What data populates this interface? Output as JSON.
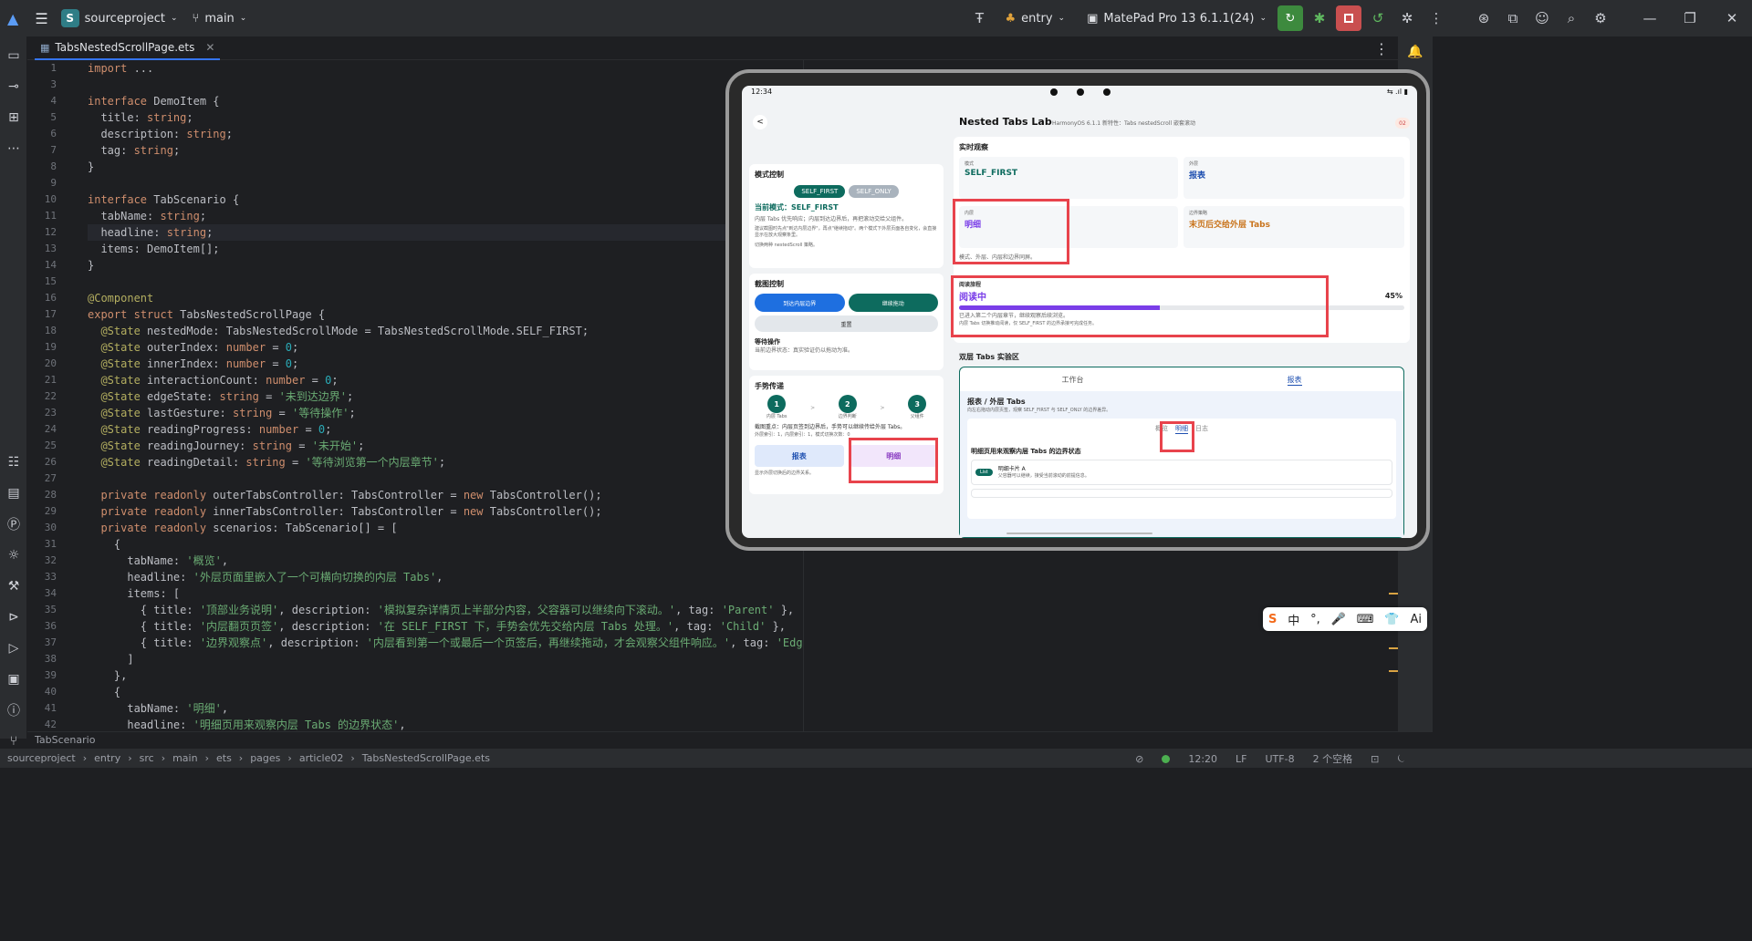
{
  "topbar": {
    "project_badge": "S",
    "project_name": "sourceproject",
    "branch": "main",
    "run_config": "entry",
    "device": "MatePad Pro 13 6.1.1(24)"
  },
  "editor": {
    "tab_name": "TabsNestedScrollPage.ets",
    "line_numbers": [
      "1",
      "3",
      "4",
      "5",
      "6",
      "7",
      "8",
      "9",
      "10",
      "11",
      "12",
      "13",
      "14",
      "15",
      "16",
      "17",
      "18",
      "19",
      "20",
      "21",
      "22",
      "23",
      "24",
      "25",
      "26",
      "27",
      "28",
      "29",
      "30",
      "31",
      "32",
      "33",
      "34",
      "35",
      "36",
      "37",
      "38",
      "39",
      "40",
      "41",
      "42"
    ],
    "code_lines": [
      "import ...",
      "",
      "interface DemoItem {",
      "  title: string;",
      "  description: string;",
      "  tag: string;",
      "}",
      "",
      "interface TabScenario {",
      "  tabName: string;",
      "  headline: string;",
      "  items: DemoItem[];",
      "}",
      "",
      "@Component",
      "export struct TabsNestedScrollPage {",
      "  @State nestedMode: TabsNestedScrollMode = TabsNestedScrollMode.SELF_FIRST;",
      "  @State outerIndex: number = 0;",
      "  @State innerIndex: number = 0;",
      "  @State interactionCount: number = 0;",
      "  @State edgeState: string = '未到达边界';",
      "  @State lastGesture: string = '等待操作';",
      "  @State readingProgress: number = 0;",
      "  @State readingJourney: string = '未开始';",
      "  @State readingDetail: string = '等待浏览第一个内层章节';",
      "",
      "  private readonly outerTabsController: TabsController = new TabsController();",
      "  private readonly innerTabsController: TabsController = new TabsController();",
      "  private readonly scenarios: TabScenario[] = [",
      "    {",
      "      tabName: '概览',",
      "      headline: '外层页面里嵌入了一个可横向切换的内层 Tabs',",
      "      items: [",
      "        { title: '顶部业务说明', description: '模拟复杂详情页上半部分内容，父容器可以继续向下滚动。', tag: 'Parent' },",
      "        { title: '内层翻页页签', description: '在 SELF_FIRST 下，手势会优先交给内层 Tabs 处理。', tag: 'Child' },",
      "        { title: '边界观察点', description: '内层看到第一个或最后一个页签后，再继续拖动，才会观察父组件响应。', tag: 'Edge' }",
      "      ]",
      "    },",
      "    {",
      "      tabName: '明细',",
      "      headline: '明细页用来观察内层 Tabs 的边界状态',"
    ],
    "bottom_crumb": "TabScenario"
  },
  "statusbar": {
    "path": [
      "sourceproject",
      "entry",
      "src",
      "main",
      "ets",
      "pages",
      "article02",
      "TabsNestedScrollPage.ets"
    ],
    "position": "12:20",
    "line_sep": "LF",
    "encoding": "UTF-8",
    "indent": "2 个空格"
  },
  "device_screen": {
    "time": "12:34",
    "back": "<",
    "title": "Nested Tabs Lab",
    "subtitle": "HarmonyOS 6.1.1 新特性：Tabs nestedScroll 嵌套滚动",
    "badge": "02",
    "mode_control": {
      "title": "模式控制",
      "btn_self_first": "SELF_FIRST",
      "btn_self_only": "SELF_ONLY",
      "current_mode": "当前模式：SELF_FIRST",
      "desc1": "内层 Tabs 优先响应；内层到达边界后，再把滚动交给父组件。",
      "desc2": "建议截图时先点\"到达内层边界\"，再点\"继续拖动\"。两个模式下外层页面各自变化，会直接显示在放大观察条里。",
      "desc3": "切换两种 nestedScroll 策略。"
    },
    "screenshot_control": {
      "title": "截图控制",
      "btn_reach": "到达内层边界",
      "btn_continue": "继续拖动",
      "btn_reset": "重置",
      "wait_title": "等待操作",
      "wait_desc": "当前边界状态：真实验证仍以拖动为准。"
    },
    "gesture": {
      "title": "手势传递",
      "steps": [
        {
          "num": "1",
          "label": "内层 Tabs"
        },
        {
          "num": "2",
          "label": "边界判断"
        },
        {
          "num": "3",
          "label": "父组件"
        }
      ],
      "result": "截图重点：内层页签到边界后，手势可以继续传给外层 Tabs。",
      "indexes": "外层索引：1，内层索引：1，模式切换次数：0",
      "btn_report": "报表",
      "btn_detail": "明细",
      "footer": "显示外层切换后的边界关系。"
    },
    "live": {
      "title": "实时观察",
      "mode_label": "模式",
      "mode_value": "SELF_FIRST",
      "outer_label": "外层",
      "outer_value": "报表",
      "inner_label": "内层",
      "inner_value": "明细",
      "edge_label": "边界策略",
      "edge_value": "末页后交给外层 Tabs",
      "note": "模式、外层、内层和边界同屏。"
    },
    "reading": {
      "title": "阅读旅程",
      "status": "阅读中",
      "percent": "45%",
      "progress": 0.45,
      "desc1": "已进入第二个内层章节，继续观察后续浏览。",
      "desc2": "内层 Tabs 切换推动阅读，仅 SELF_FIRST 的边界承接可完成任务。"
    },
    "lab": {
      "title": "双层 Tabs 实验区",
      "outer_tabs": [
        "工作台",
        "报表"
      ],
      "headline": "报表 / 外层 Tabs",
      "desc": "向左右拖动内层页签，观察 SELF_FIRST 与 SELF_ONLY 的边界差异。",
      "inner_tabs": [
        "概览",
        "明细",
        "日志"
      ],
      "subheading": "明细页用来观察内层 Tabs 的边界状态",
      "item_tag": "List",
      "item_title": "明细卡片 A",
      "item_desc": "父容器可以继续，接受当前滚动的前提信息。"
    }
  },
  "ime": {
    "items": [
      "S",
      "中",
      "°,",
      "🎤",
      "⌨",
      "👕",
      "Ai"
    ]
  },
  "colors": {
    "accent": "#3574f0",
    "teal": "#0d6b5e",
    "purple": "#7a3ee8",
    "highlight": "#e8434c"
  }
}
